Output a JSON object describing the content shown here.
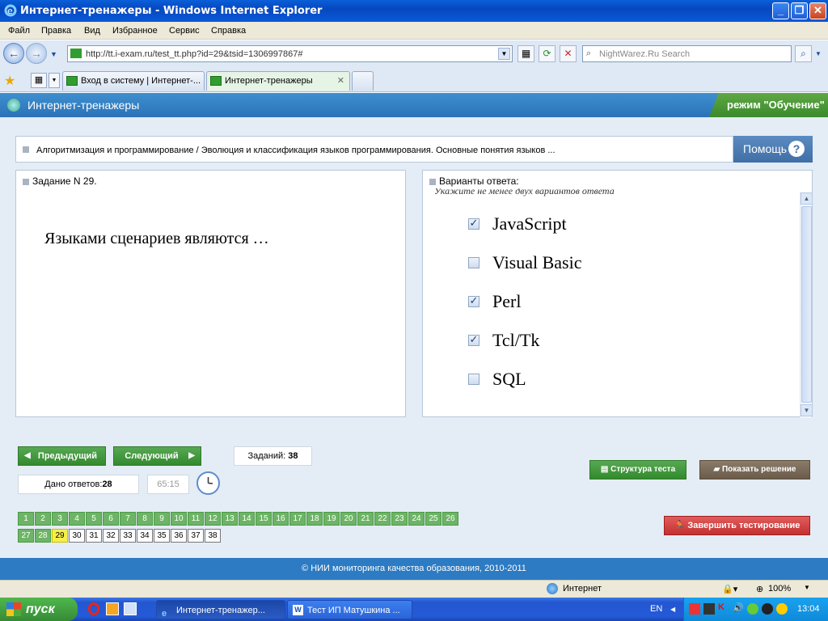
{
  "window": {
    "title": "Интернет-тренажеры - Windows Internet Explorer"
  },
  "menu": [
    "Файл",
    "Правка",
    "Вид",
    "Избранное",
    "Сервис",
    "Справка"
  ],
  "address": {
    "url": "http://tt.i-exam.ru/test_tt.php?id=29&tsid=1306997867#"
  },
  "search": {
    "placeholder": "NightWarez.Ru Search"
  },
  "tabs": [
    {
      "label": "Вход в систему | Интернет-..."
    },
    {
      "label": "Интернет-тренажеры"
    }
  ],
  "page": {
    "app_title": "Интернет-тренажеры",
    "mode": "режим \"Обучение\"",
    "breadcrumb": "Алгоритмизация и программирование / Эволюция и классификация языков программирования. Основные понятия языков ...",
    "help_label": "Помощь",
    "task_header": "Задание N 29.",
    "question": "Языками сценариев являются …",
    "answers_header": "Варианты ответа:",
    "answers_hint": "Укажите не менее двух вариантов ответа",
    "options": [
      {
        "label": "JavaScript",
        "checked": true
      },
      {
        "label": "Visual Basic",
        "checked": false
      },
      {
        "label": "Perl",
        "checked": true
      },
      {
        "label": "Tcl/Tk",
        "checked": true
      },
      {
        "label": "SQL",
        "checked": false
      }
    ]
  },
  "controls": {
    "prev": "Предыдущий",
    "next": "Следующий",
    "tasks_label": "Заданий:",
    "tasks_count": "38",
    "answered_label": "Дано ответов:",
    "answered_count": "28",
    "timer": "65:15",
    "structure": "Структура теста",
    "show_solution": "Показать решение",
    "finish": "Завершить тестирование"
  },
  "task_numbers": [
    "1",
    "2",
    "3",
    "4",
    "5",
    "6",
    "7",
    "8",
    "9",
    "10",
    "11",
    "12",
    "13",
    "14",
    "15",
    "16",
    "17",
    "18",
    "19",
    "20",
    "21",
    "22",
    "23",
    "24",
    "25",
    "26",
    "27",
    "28",
    "29",
    "30",
    "31",
    "32",
    "33",
    "34",
    "35",
    "36",
    "37",
    "38"
  ],
  "current_task": "29",
  "answered_up_to": 28,
  "footer": "© НИИ мониторинга качества образования, 2010-2011",
  "statusbar": {
    "zone": "Интернет",
    "zoom": "100%"
  },
  "taskbar": {
    "start": "пуск",
    "tasks": [
      "Интернет-тренажер...",
      "Тест ИП Матушкина ..."
    ],
    "lang": "EN",
    "clock": "13:04"
  }
}
